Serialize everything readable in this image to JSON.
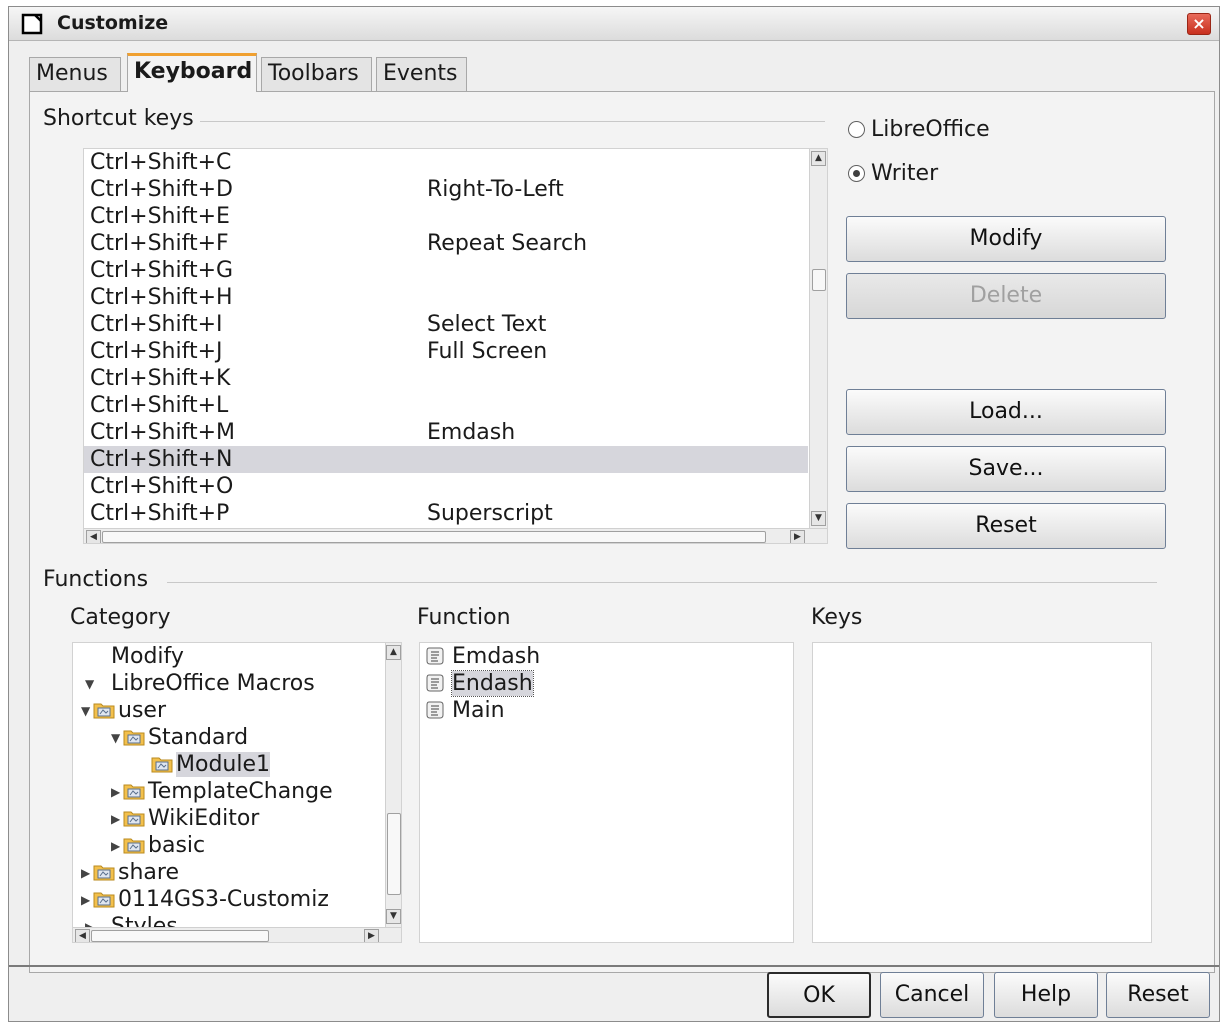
{
  "window": {
    "title": "Customize",
    "close_symbol": "×"
  },
  "tabs": [
    {
      "label": "Menus",
      "active": false
    },
    {
      "label": "Keyboard",
      "active": true
    },
    {
      "label": "Toolbars",
      "active": false
    },
    {
      "label": "Events",
      "active": false
    }
  ],
  "shortcut_section": {
    "label": "Shortcut keys"
  },
  "scope_options": {
    "libreoffice": {
      "label": "LibreOffice",
      "selected": false
    },
    "writer": {
      "label": "Writer",
      "selected": true
    }
  },
  "shortcuts": [
    {
      "key": "Ctrl+Shift+C",
      "function": ""
    },
    {
      "key": "Ctrl+Shift+D",
      "function": "Right-To-Left"
    },
    {
      "key": "Ctrl+Shift+E",
      "function": ""
    },
    {
      "key": "Ctrl+Shift+F",
      "function": "Repeat Search"
    },
    {
      "key": "Ctrl+Shift+G",
      "function": ""
    },
    {
      "key": "Ctrl+Shift+H",
      "function": ""
    },
    {
      "key": "Ctrl+Shift+I",
      "function": "Select Text"
    },
    {
      "key": "Ctrl+Shift+J",
      "function": "Full Screen"
    },
    {
      "key": "Ctrl+Shift+K",
      "function": ""
    },
    {
      "key": "Ctrl+Shift+L",
      "function": ""
    },
    {
      "key": "Ctrl+Shift+M",
      "function": "Emdash"
    },
    {
      "key": "Ctrl+Shift+N",
      "function": "",
      "selected": true
    },
    {
      "key": "Ctrl+Shift+O",
      "function": ""
    },
    {
      "key": "Ctrl+Shift+P",
      "function": "Superscript"
    }
  ],
  "side_buttons": {
    "modify": "Modify",
    "delete": "Delete",
    "load": "Load...",
    "save": "Save...",
    "reset": "Reset"
  },
  "functions_section": {
    "label": "Functions",
    "category_label": "Category",
    "function_label": "Function",
    "keys_label": "Keys"
  },
  "category_tree": [
    {
      "label": "Modify",
      "level": 0,
      "expander": "none",
      "folder": false
    },
    {
      "label": "LibreOffice Macros",
      "level": 0,
      "expander": "down",
      "folder": false
    },
    {
      "label": "user",
      "level": 1,
      "expander": "down",
      "folder": true
    },
    {
      "label": "Standard",
      "level": 2,
      "expander": "down",
      "folder": true
    },
    {
      "label": "Module1",
      "level": 3,
      "expander": "none",
      "folder": true,
      "selected": true
    },
    {
      "label": "TemplateChange",
      "level": 2,
      "expander": "right",
      "folder": true
    },
    {
      "label": "WikiEditor",
      "level": 2,
      "expander": "right",
      "folder": true
    },
    {
      "label": "basic",
      "level": 2,
      "expander": "right",
      "folder": true
    },
    {
      "label": "share",
      "level": 1,
      "expander": "right",
      "folder": true
    },
    {
      "label": "0114GS3-Customiz",
      "level": 1,
      "expander": "right",
      "folder": true
    },
    {
      "label": "Styles",
      "level": 0,
      "expander": "right",
      "folder": false
    }
  ],
  "function_list": [
    {
      "label": "Emdash",
      "icon": "macro-icon",
      "selected": false
    },
    {
      "label": "Endash",
      "icon": "macro-icon",
      "selected": true
    },
    {
      "label": "Main",
      "icon": "macro-icon",
      "selected": false
    }
  ],
  "footer_buttons": {
    "ok": "OK",
    "cancel": "Cancel",
    "help": "Help",
    "reset": "Reset"
  }
}
